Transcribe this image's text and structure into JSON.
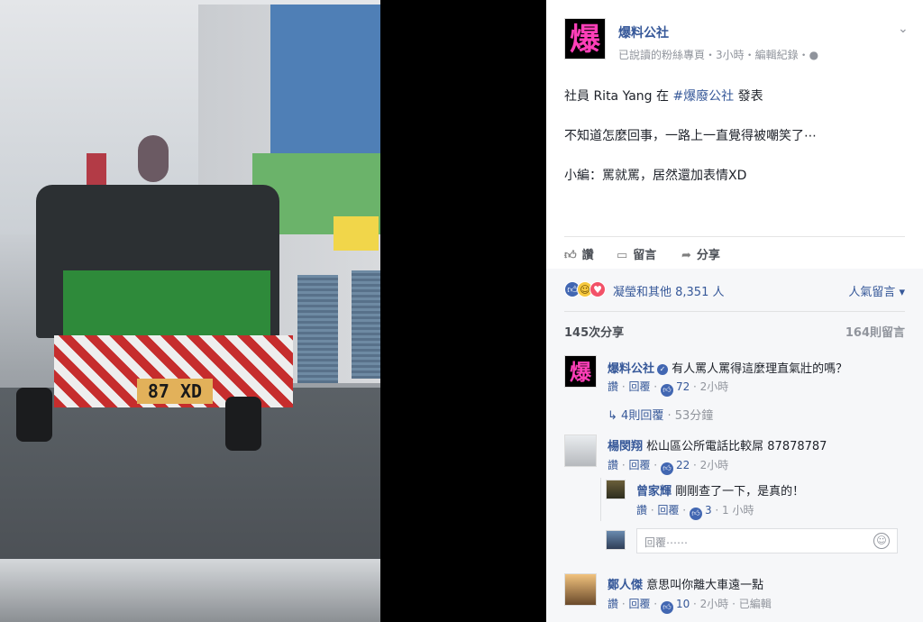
{
  "post": {
    "page_logo": "爆",
    "page_name": "爆料公社",
    "meta": "已說讀的粉絲專頁・3小時・編輯紀錄・",
    "line1_prefix": "社員 Rita Yang 在 ",
    "line1_link": "#爆廢公社",
    "line1_suffix": " 發表",
    "line2": "不知道怎麼回事，一路上一直覺得被嘲笑了⋯",
    "line3": "小編：罵就罵，居然還加表情XD",
    "photo_plate": "87 XD"
  },
  "actions": {
    "like": "讚",
    "comment": "留言",
    "share": "分享"
  },
  "reactions": {
    "summary": "凝瑩和其他 8,351 人",
    "sort_label": "人氣留言",
    "shares": "145次分享",
    "comment_count": "164則留言"
  },
  "comments": [
    {
      "name": "爆料公社",
      "text": "有人罵人罵得這麼理直氣壯的嗎？",
      "like_label": "讚",
      "reply_label": "回覆",
      "likes": "72",
      "time": "2小時"
    },
    {
      "name": "楊閔翔",
      "text": "松山區公所電話比較屌 87878787",
      "like_label": "讚",
      "reply_label": "回覆",
      "likes": "22",
      "time": "2小時"
    },
    {
      "name": "鄭人傑",
      "text": "意思叫你離大車遠一點",
      "like_label": "讚",
      "reply_label": "回覆",
      "likes": "10",
      "time": "2小時",
      "edited": "已編輯"
    }
  ],
  "thread": {
    "replies_link": "4則回覆",
    "replies_time": "53分鐘"
  },
  "reply": {
    "name": "曾家輝",
    "text": "剛剛查了一下，是真的！",
    "like_label": "讚",
    "reply_label": "回覆",
    "likes": "3",
    "time": "1 小時"
  },
  "reply_box": {
    "placeholder": "回覆⋯⋯"
  }
}
